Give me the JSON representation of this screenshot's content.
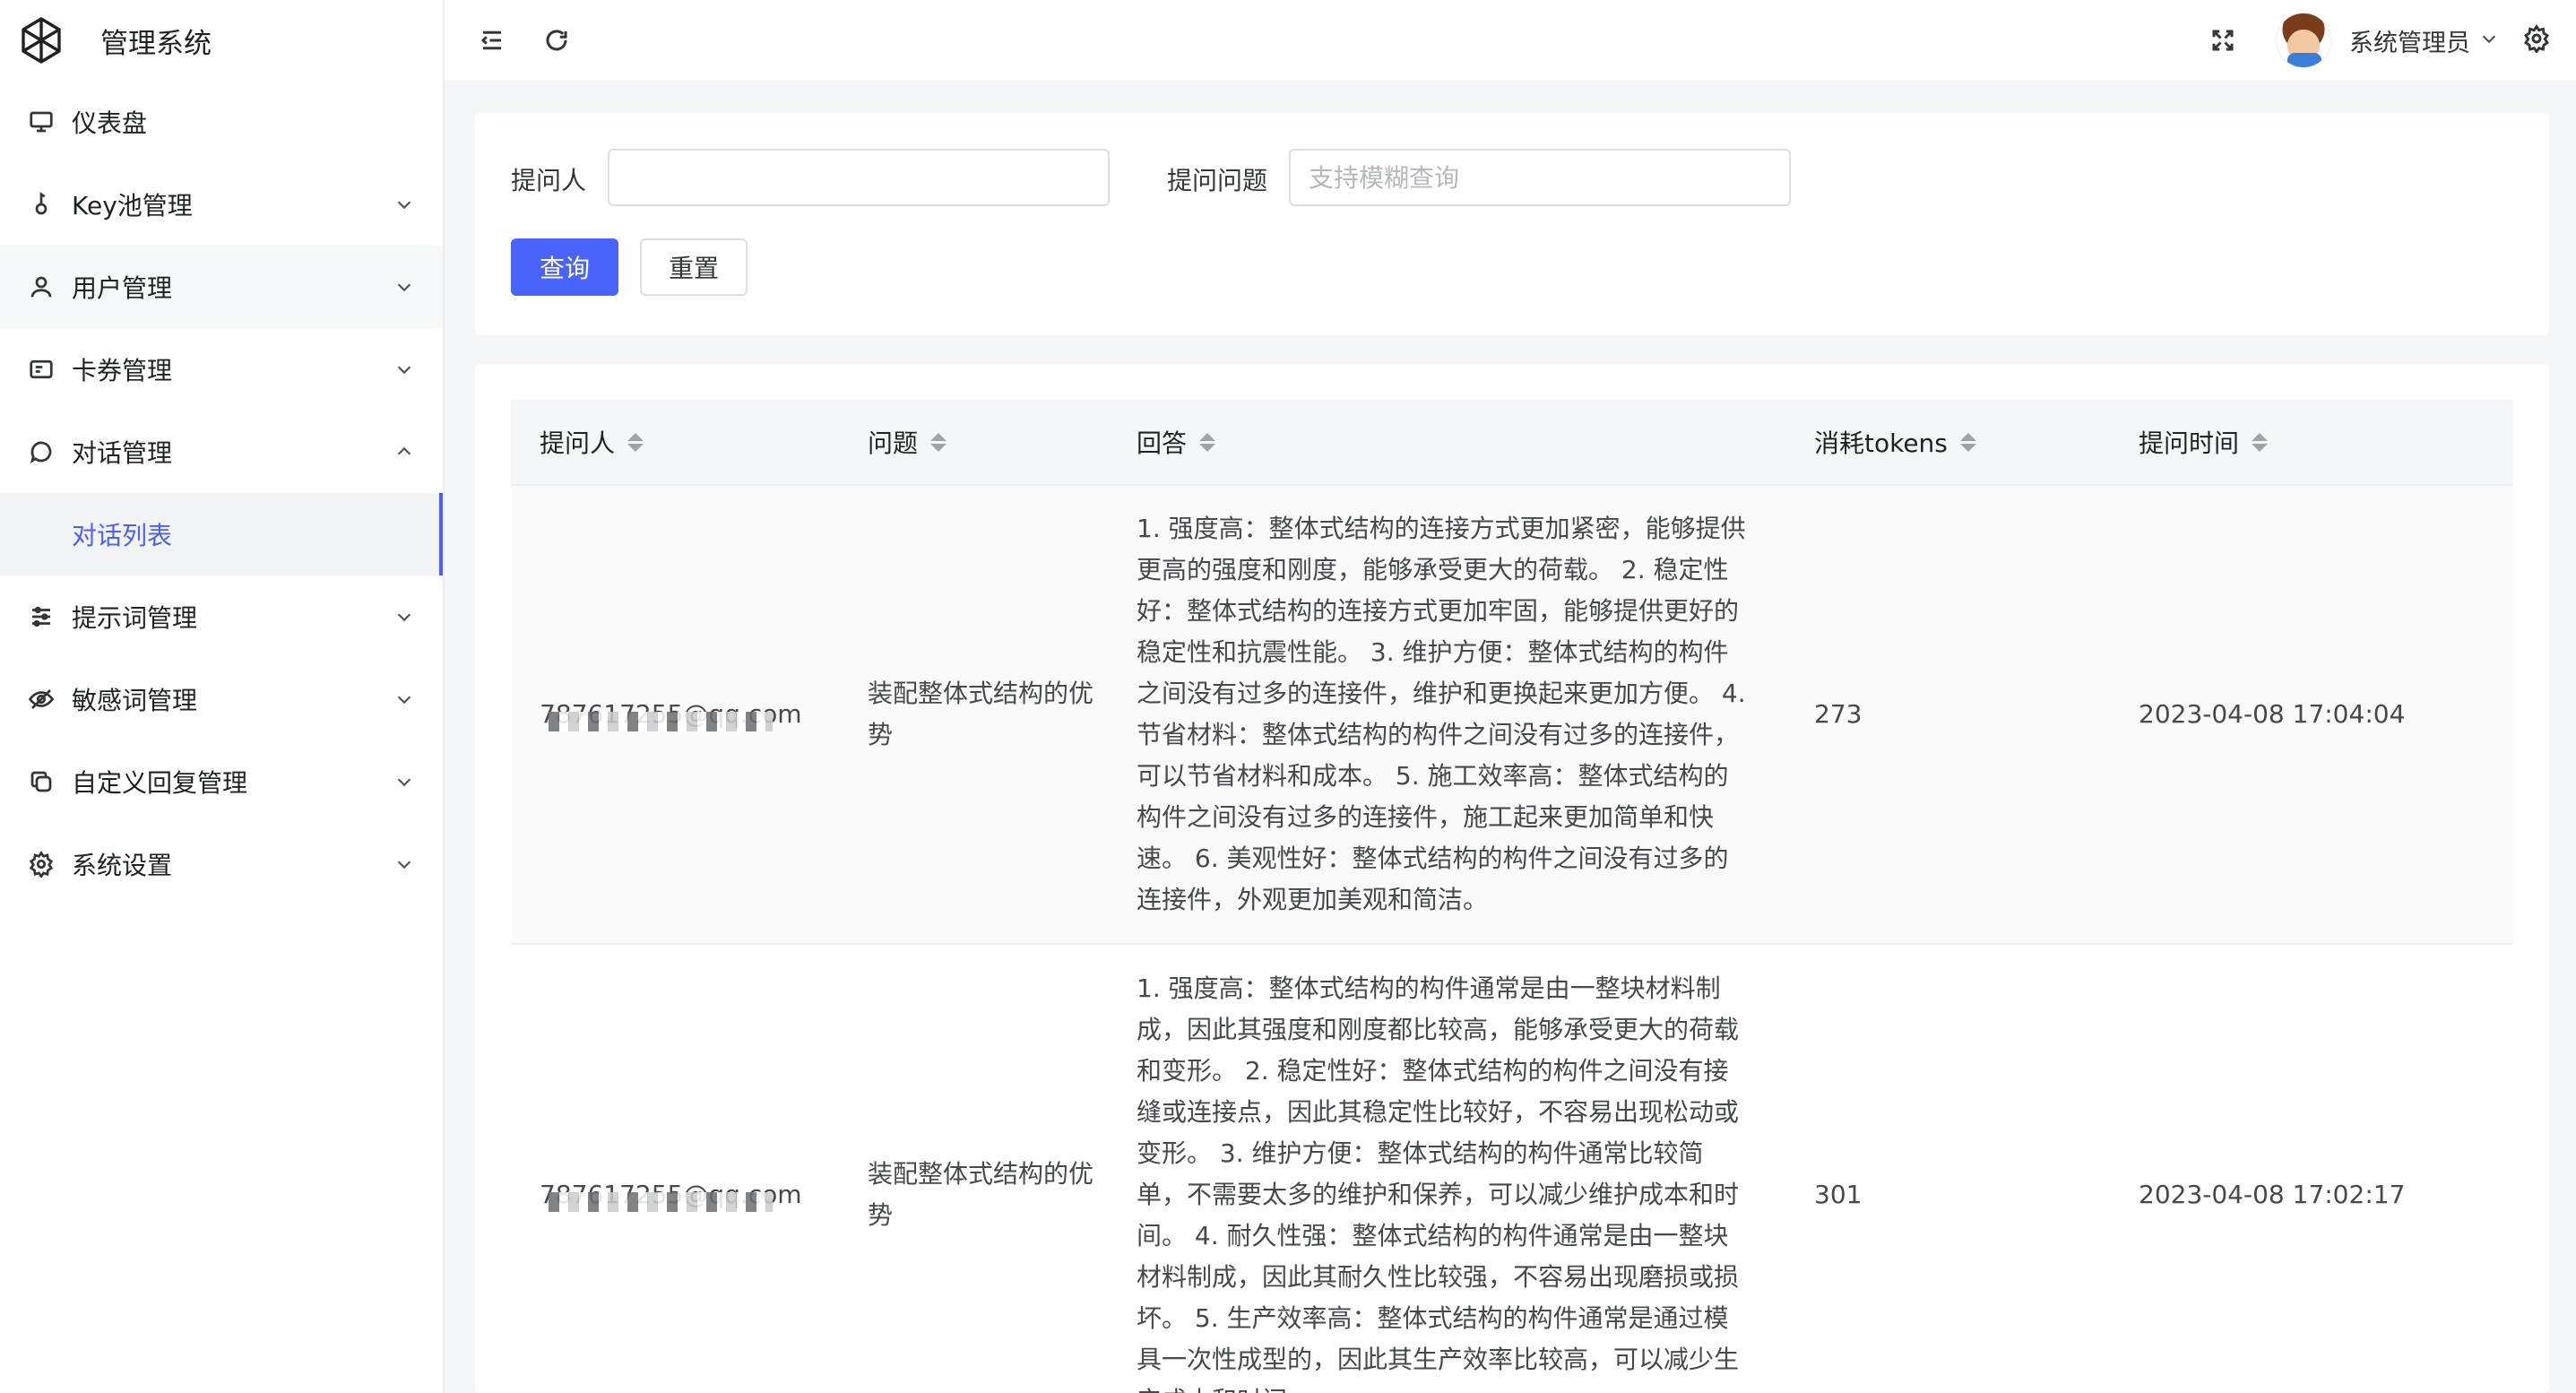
{
  "app": {
    "title": "管理系统"
  },
  "sidebar": {
    "items": [
      {
        "label": "仪表盘",
        "icon": "monitor-icon",
        "expandable": false
      },
      {
        "label": "Key池管理",
        "icon": "key-icon",
        "expandable": true,
        "expanded": false
      },
      {
        "label": "用户管理",
        "icon": "user-icon",
        "expandable": true,
        "expanded": false
      },
      {
        "label": "卡券管理",
        "icon": "card-icon",
        "expandable": true,
        "expanded": false
      },
      {
        "label": "对话管理",
        "icon": "chat-icon",
        "expandable": true,
        "expanded": true
      },
      {
        "label": "对话列表",
        "icon": "",
        "expandable": false,
        "active": true
      },
      {
        "label": "提示词管理",
        "icon": "sliders-icon",
        "expandable": true,
        "expanded": false
      },
      {
        "label": "敏感词管理",
        "icon": "eye-off-icon",
        "expandable": true,
        "expanded": false
      },
      {
        "label": "自定义回复管理",
        "icon": "copy-icon",
        "expandable": true,
        "expanded": false
      },
      {
        "label": "系统设置",
        "icon": "gear-icon",
        "expandable": true,
        "expanded": false
      }
    ]
  },
  "header": {
    "user_name": "系统管理员",
    "icons": [
      "menu-fold-icon",
      "refresh-icon",
      "fullscreen-icon",
      "avatar",
      "chevron-down-icon",
      "gear-icon"
    ]
  },
  "search": {
    "asker_label": "提问人",
    "asker_value": "",
    "question_label": "提问问题",
    "question_placeholder": "支持模糊查询",
    "submit_label": "查询",
    "reset_label": "重置"
  },
  "table": {
    "columns": [
      "提问人",
      "问题",
      "回答",
      "消耗tokens",
      "提问时间"
    ],
    "rows": [
      {
        "asker": "787617255@qq.com",
        "question": "装配整体式结构的优势",
        "answer": "1. 强度高：整体式结构的连接方式更加紧密，能够提供更高的强度和刚度，能够承受更大的荷载。 2. 稳定性好：整体式结构的连接方式更加牢固，能够提供更好的稳定性和抗震性能。 3. 维护方便：整体式结构的构件之间没有过多的连接件，维护和更换起来更加方便。 4. 节省材料：整体式结构的构件之间没有过多的连接件，可以节省材料和成本。 5. 施工效率高：整体式结构的构件之间没有过多的连接件，施工起来更加简单和快速。 6. 美观性好：整体式结构的构件之间没有过多的连接件，外观更加美观和简洁。",
        "tokens": "273",
        "time": "2023-04-08 17:04:04"
      },
      {
        "asker": "787617255@qq.com",
        "question": "装配整体式结构的优势",
        "answer": "1. 强度高：整体式结构的构件通常是由一整块材料制成，因此其强度和刚度都比较高，能够承受更大的荷载和变形。 2. 稳定性好：整体式结构的构件之间没有接缝或连接点，因此其稳定性比较好，不容易出现松动或变形。 3. 维护方便：整体式结构的构件通常比较简单，不需要太多的维护和保养，可以减少维护成本和时间。 4. 耐久性强：整体式结构的构件通常是由一整块材料制成，因此其耐久性比较强，不容易出现磨损或损坏。 5. 生产效率高：整体式结构的构件通常是通过模具一次性成型的，因此其生产效率比较高，可以减少生产成本和时间。",
        "tokens": "301",
        "time": "2023-04-08 17:02:17"
      }
    ]
  },
  "colors": {
    "primary": "#4a64fb",
    "active_menu_bg": "#f2f3f5",
    "page_bg": "#f5f6f7"
  }
}
